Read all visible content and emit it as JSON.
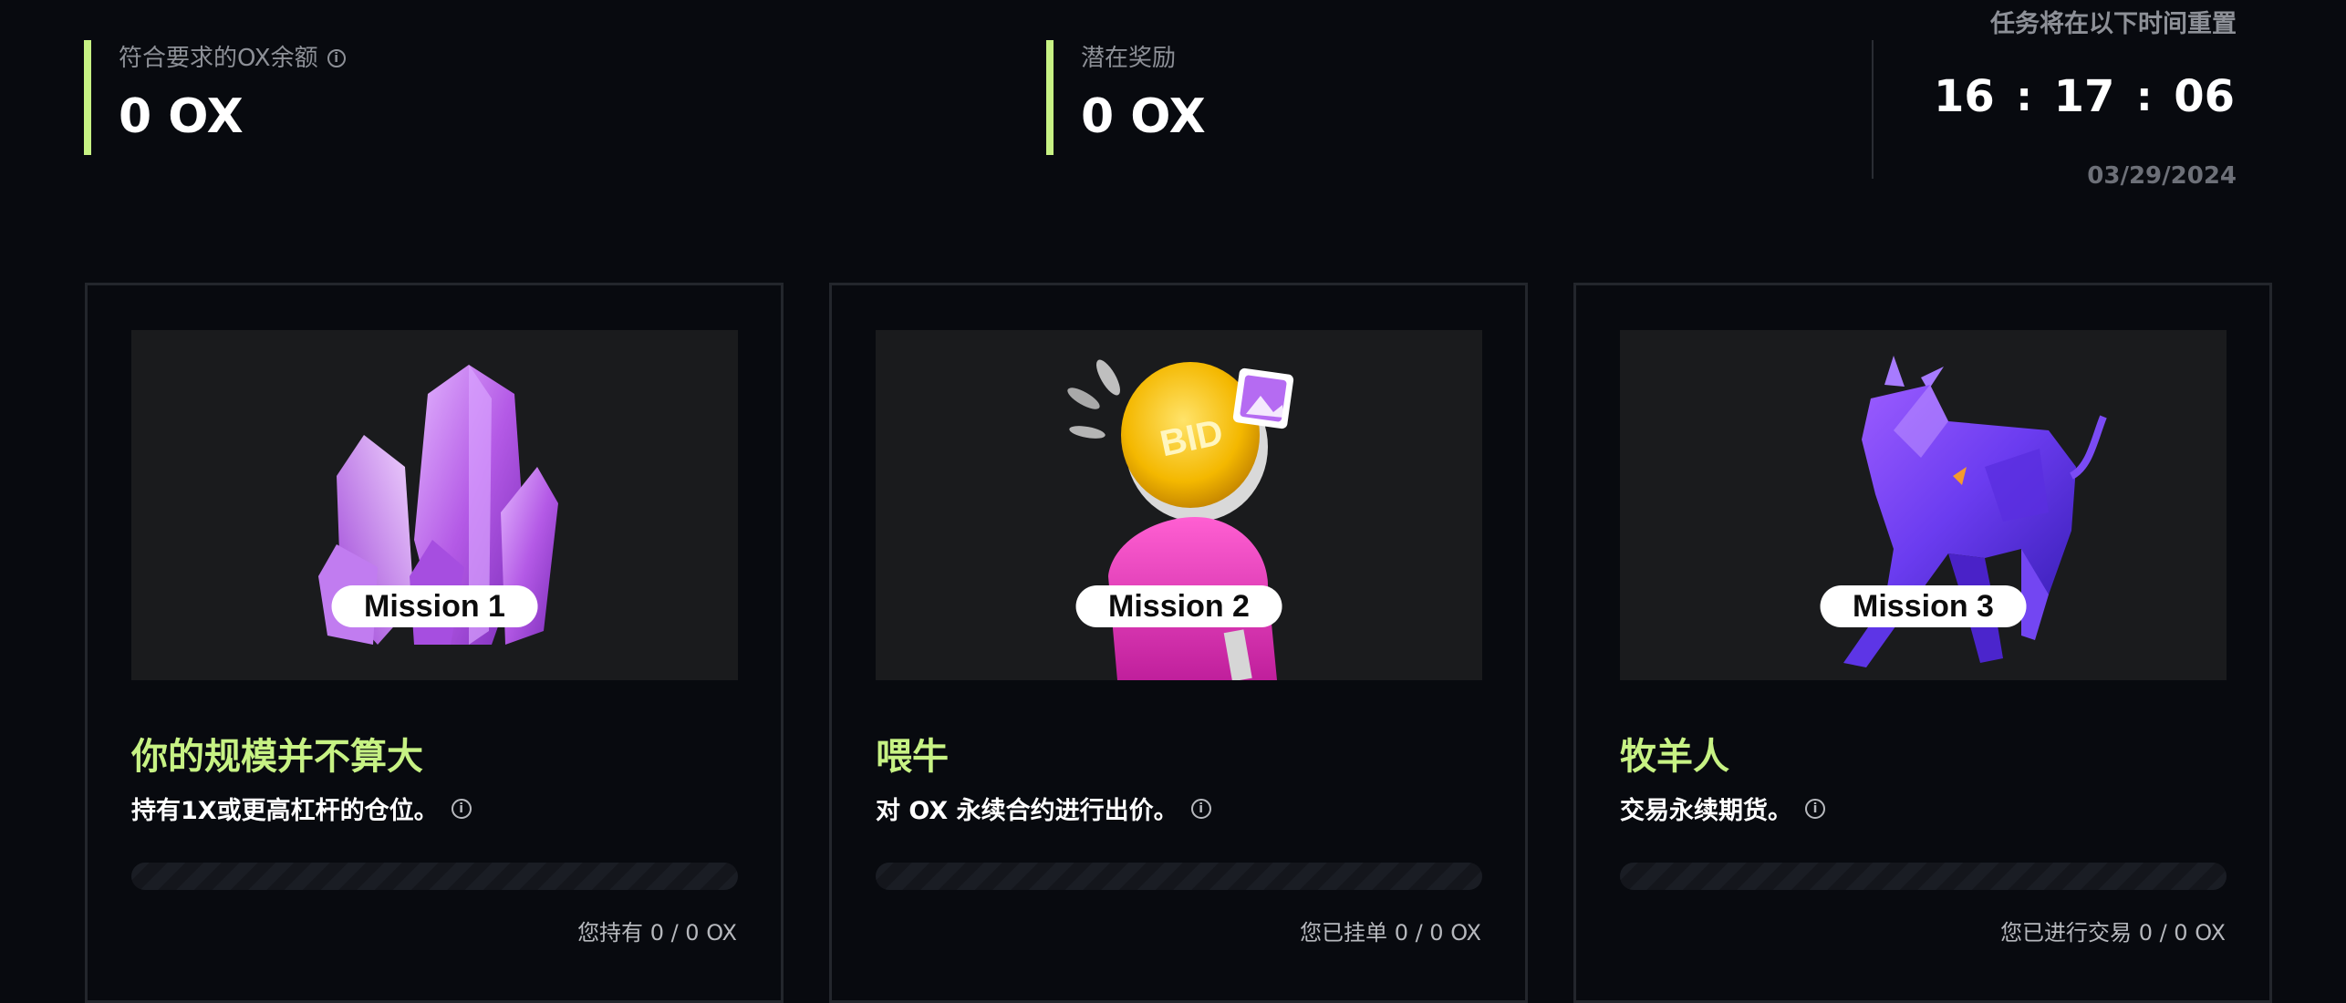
{
  "stats": {
    "eligible_label": "符合要求的OX余额",
    "eligible_value": "0 OX",
    "reward_label": "潜在奖励",
    "reward_value": "0 OX"
  },
  "reset": {
    "label": "任务将在以下时间重置",
    "hours": "16",
    "minutes": "17",
    "seconds": "06",
    "separator": ":",
    "date": "03/29/2024"
  },
  "missions": [
    {
      "badge": "Mission 1",
      "title": "你的规模并不算大",
      "description": "持有1X或更高杠杆的仓位。",
      "status": "您持有 0 / 0 OX",
      "progress": 0,
      "image": "amethyst-crystal-icon"
    },
    {
      "badge": "Mission 2",
      "title": "喂牛",
      "description": "对 OX 永续合约进行出价。",
      "status": "您已挂单 0 / 0 OX",
      "progress": 0,
      "image": "bid-coin-hand-icon"
    },
    {
      "badge": "Mission 3",
      "title": "牧羊人",
      "description": "交易永续期货。",
      "status": "您已进行交易 0 / 0 OX",
      "progress": 0,
      "image": "purple-bull-icon"
    }
  ],
  "colors": {
    "accent": "#c7f284",
    "background": "#080a0f",
    "card_media": "#1a1b1d"
  }
}
